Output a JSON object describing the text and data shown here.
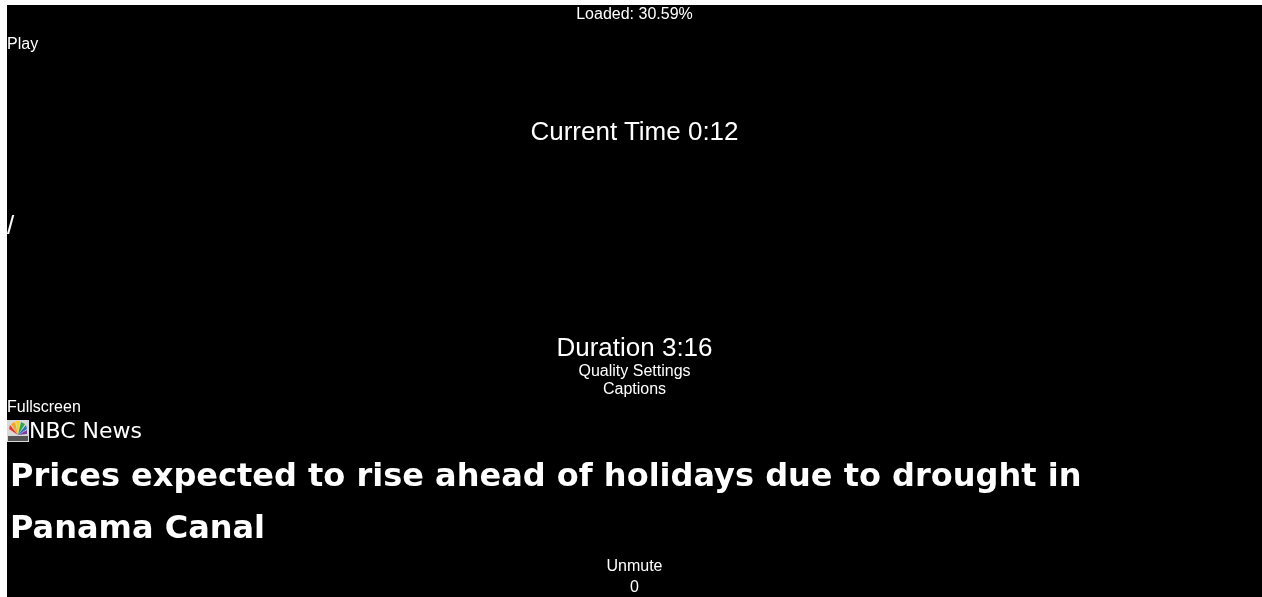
{
  "player": {
    "loaded": "Loaded: 30.59%",
    "play_button": "Play",
    "current_time": "Current Time 0:12",
    "separator": "/",
    "duration": "Duration 3:16",
    "quality_button": "Quality Settings",
    "captions_button": "Captions",
    "fullscreen_button": "Fullscreen"
  },
  "source": {
    "name": "NBC News"
  },
  "headline": "Prices expected to rise ahead of holidays due to drought in Panama Canal",
  "volume": {
    "mute_button": "Unmute",
    "value": "0"
  }
}
